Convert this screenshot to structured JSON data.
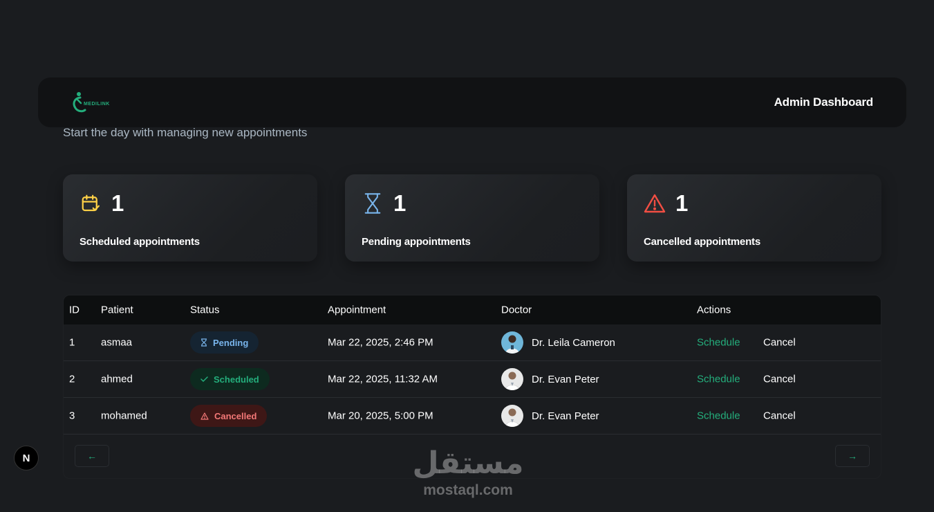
{
  "header": {
    "logo_text": "MEDILINK",
    "title": "Admin Dashboard"
  },
  "subtitle": "Start the day with managing new appointments",
  "stats": [
    {
      "icon": "calendar-check-icon",
      "count": "1",
      "label": "Scheduled appointments",
      "color": "#ffd147"
    },
    {
      "icon": "hourglass-icon",
      "count": "1",
      "label": "Pending appointments",
      "color": "#79b5ec"
    },
    {
      "icon": "warning-triangle-icon",
      "count": "1",
      "label": "Cancelled appointments",
      "color": "#f24e43"
    }
  ],
  "table": {
    "columns": [
      "ID",
      "Patient",
      "Status",
      "Appointment",
      "Doctor",
      "Actions"
    ],
    "rows": [
      {
        "id": "1",
        "patient": "asmaa",
        "status": "Pending",
        "appointment": "Mar 22, 2025, 2:46 PM",
        "doctor": "Dr. Leila Cameron",
        "schedule": "Schedule",
        "cancel": "Cancel"
      },
      {
        "id": "2",
        "patient": "ahmed",
        "status": "Scheduled",
        "appointment": "Mar 22, 2025, 11:32 AM",
        "doctor": "Dr. Evan Peter",
        "schedule": "Schedule",
        "cancel": "Cancel"
      },
      {
        "id": "3",
        "patient": "mohamed",
        "status": "Cancelled",
        "appointment": "Mar 20, 2025, 5:00 PM",
        "doctor": "Dr. Evan Peter",
        "schedule": "Schedule",
        "cancel": "Cancel"
      }
    ],
    "pager": {
      "prev": "←",
      "next": "→"
    }
  },
  "devtools": {
    "label": "N"
  },
  "watermark": {
    "arabic": "مستقل",
    "latin": "mostaql.com"
  },
  "colors": {
    "background": "#1a1c1f",
    "accent_green": "#24ae7c",
    "pending_blue": "#79b5ec",
    "cancel_red": "#f37877",
    "scheduled_yellow": "#ffd147"
  }
}
